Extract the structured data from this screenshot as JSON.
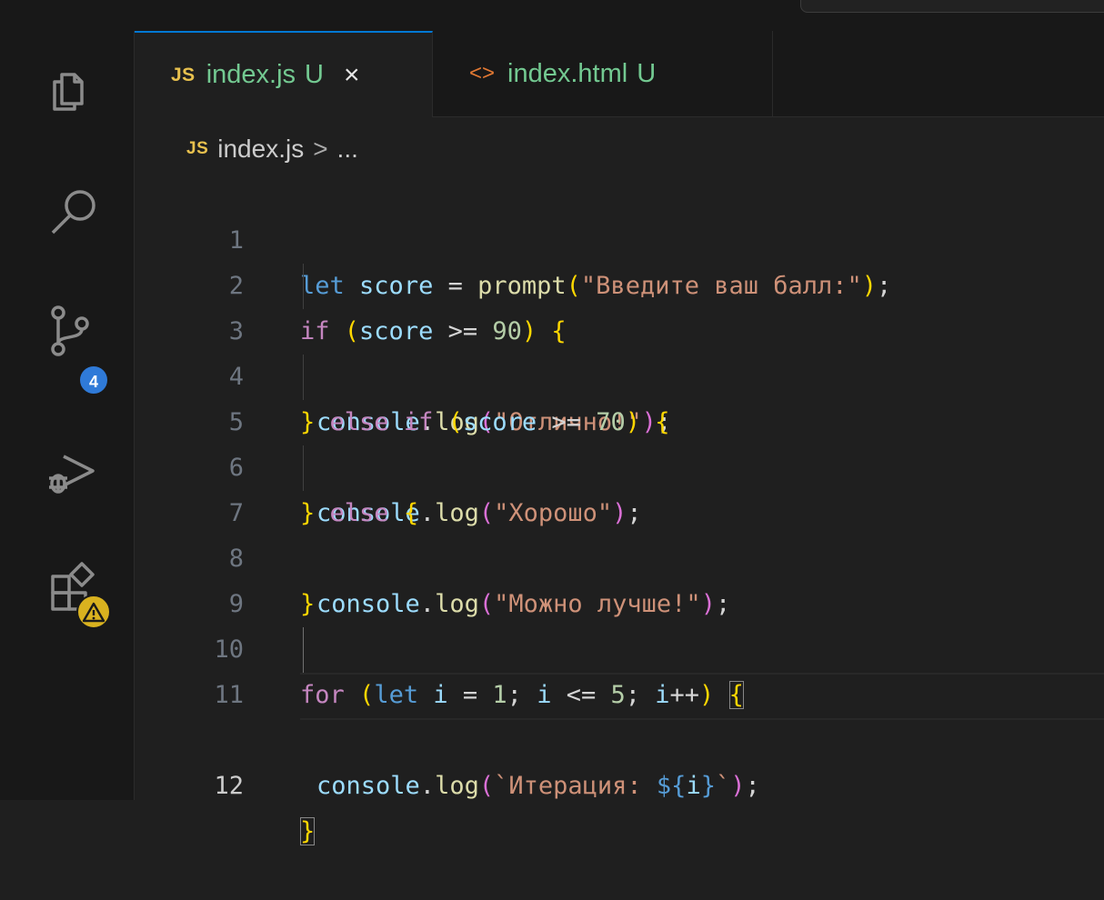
{
  "tabs": [
    {
      "icon": "JS",
      "name": "index.js",
      "status": "U",
      "close": "×",
      "active": true
    },
    {
      "icon": "<>",
      "name": "index.html",
      "status": "U",
      "active": false
    }
  ],
  "breadcrumb": {
    "icon": "JS",
    "file": "index.js",
    "separator": ">",
    "rest": "..."
  },
  "activity": {
    "scm_badge": "4"
  },
  "code": {
    "lines": [
      "1",
      "2",
      "3",
      "4",
      "5",
      "6",
      "7",
      "8",
      "9",
      "10",
      "11",
      "12"
    ],
    "l1": {
      "kw": "let",
      "var": "score",
      "op": " = ",
      "fn": "prompt",
      "str": "\"Введите ваш балл:\"",
      "end": ";"
    },
    "l2": {
      "kw": "if",
      "var": "score",
      "op": " >= ",
      "num": "90"
    },
    "l3": {
      "obj": "console",
      "dot": ".",
      "fn": "log",
      "str": "\"Отлично!\"",
      "end": ";"
    },
    "l4": {
      "kw1": "else",
      "kw2": "if",
      "var": "score",
      "op": " >= ",
      "num": "70"
    },
    "l5": {
      "obj": "console",
      "dot": ".",
      "fn": "log",
      "str": "\"Хорошо\"",
      "end": ";"
    },
    "l6": {
      "kw": "else"
    },
    "l7": {
      "obj": "console",
      "dot": ".",
      "fn": "log",
      "str": "\"Можно лучше!\"",
      "end": ";"
    },
    "l10": {
      "kw": "for",
      "decl": "let",
      "var": "i",
      "op": " = ",
      "num1": "1",
      "semi": "; ",
      "var2": "i",
      "op2": " <= ",
      "num2": "5",
      "var3": "i",
      "inc": "++"
    },
    "l11": {
      "obj": "console",
      "dot": ".",
      "fn": "log",
      "tstart": "`Итерация: ",
      "interp_open": "${",
      "var": "i",
      "interp_close": "}",
      "tend": "`",
      "end": ";"
    }
  }
}
